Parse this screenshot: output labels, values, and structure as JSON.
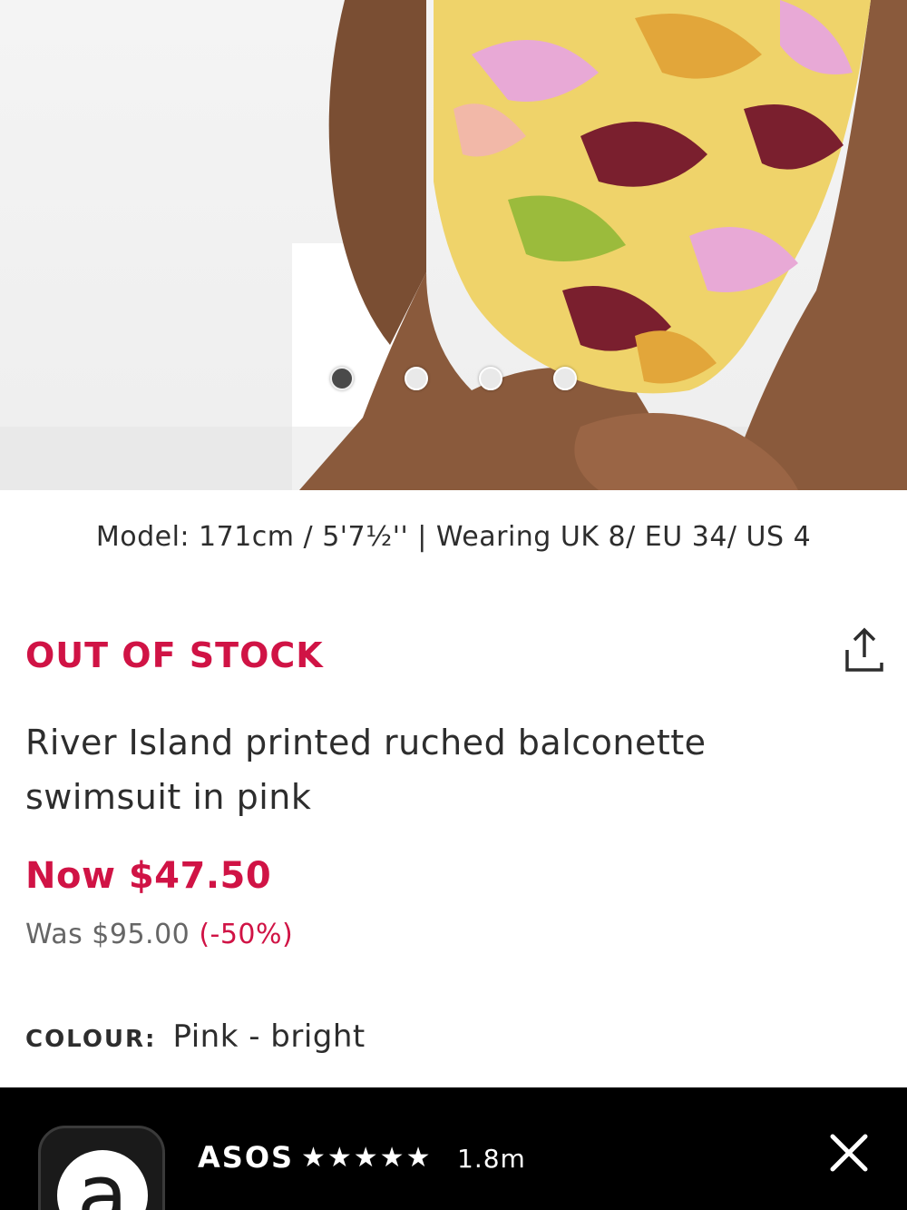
{
  "product_image": {
    "alt_icon": "product-photo",
    "carousel": {
      "count": 4,
      "active_index": 0
    }
  },
  "model_info": "Model: 171cm / 5'7½'' | Wearing UK 8/ EU 34/ US 4",
  "stock_status": "OUT OF STOCK",
  "share_icon": "share-icon",
  "product_title": "River Island printed ruched balconette swimsuit in pink",
  "price": {
    "now": "Now $47.50",
    "was": "Was $95.00",
    "discount": "(-50%)"
  },
  "colour": {
    "label": "COLOUR:",
    "value": "Pink - bright"
  },
  "app_banner": {
    "icon": "asos-app-icon",
    "icon_letter": "a",
    "name": "ASOS",
    "stars": "★★★★★",
    "rating_stars": 5,
    "reviews": "1.8m",
    "close_icon": "close-icon"
  },
  "colors": {
    "accent": "#d01345",
    "text": "#2d2d2d",
    "muted": "#666666",
    "banner_bg": "#000000"
  }
}
